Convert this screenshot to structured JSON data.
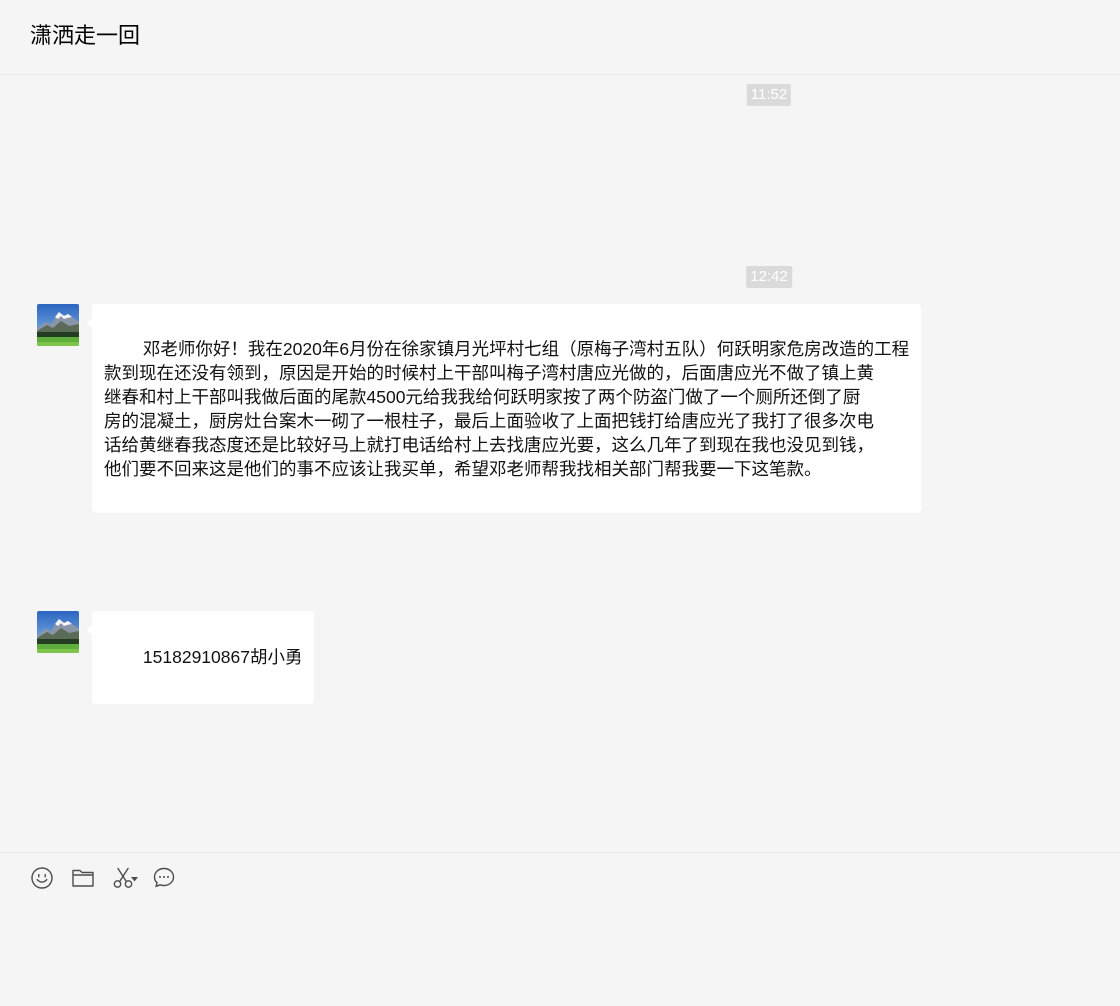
{
  "window": {
    "title": "潇洒走一回"
  },
  "chat": {
    "items": [
      {
        "kind": "timestamp",
        "text": "11:52"
      },
      {
        "kind": "timestamp",
        "text": "12:42"
      },
      {
        "kind": "message",
        "avatar": "landscape-avatar",
        "text": "邓老师你好！我在2020年6月份在徐家镇月光坪村七组（原梅子湾村五队）何跃明家危房改造的工程\n款到现在还没有领到，原因是开始的时候村上干部叫梅子湾村唐应光做的，后面唐应光不做了镇上黄\n继春和村上干部叫我做后面的尾款4500元给我我给何跃明家按了两个防盗门做了一个厕所还倒了厨\n房的混凝土，厨房灶台案木一砌了一根柱子，最后上面验收了上面把钱打给唐应光了我打了很多次电\n话给黄继春我态度还是比较好马上就打电话给村上去找唐应光要，这么几年了到现在我也没见到钱，\n他们要不回来这是他们的事不应该让我买单，希望邓老师帮我找相关部门帮我要一下这笔款。"
      },
      {
        "kind": "message",
        "avatar": "landscape-avatar",
        "text": "15182910867胡小勇"
      }
    ]
  },
  "toolbar": {
    "icons": [
      "smiley-icon",
      "folder-icon",
      "scissors-icon",
      "chevron-down-icon",
      "chat-bubble-icon"
    ]
  },
  "input": {
    "value": ""
  },
  "colors": {
    "background": "#f5f5f5",
    "bubble": "#ffffff",
    "timestamp_background": "#dadada",
    "timestamp_text": "#ffffff",
    "divider": "#e7e7e7",
    "icon": "#4d4d4d"
  }
}
